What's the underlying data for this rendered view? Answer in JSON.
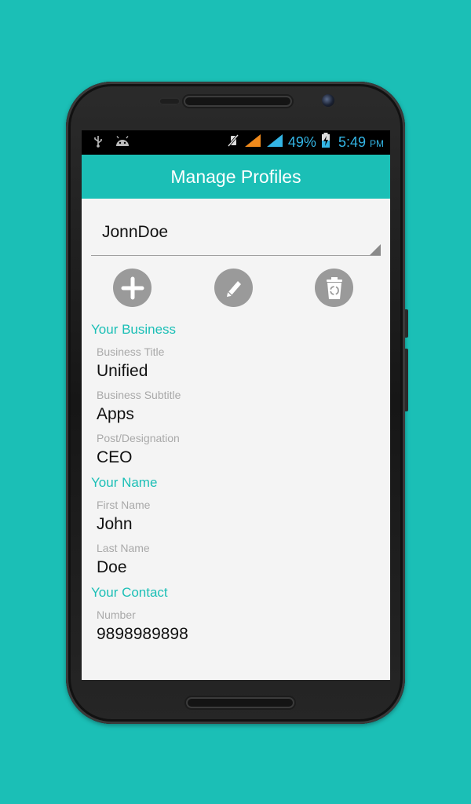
{
  "colors": {
    "accent": "#1bbfb6",
    "status_blue": "#33b5e5",
    "icon_grey": "#9a9a9a"
  },
  "statusbar": {
    "left_icons": [
      "usb-icon",
      "android-debug-icon"
    ],
    "right_icons": [
      "mute-vibrate-icon",
      "signal-orange-icon",
      "signal-blue-icon",
      "battery-charging-icon"
    ],
    "battery": "49%",
    "time": "5:49",
    "ampm": "PM"
  },
  "appbar": {
    "title": "Manage Profiles"
  },
  "profile_select": {
    "selected": "JonnDoe"
  },
  "actions": {
    "add_icon": "plus-icon",
    "edit_icon": "pencil-icon",
    "delete_icon": "trash-recycle-icon"
  },
  "business": {
    "heading": "Your Business",
    "title_label": "Business Title",
    "title_value": "Unified",
    "subtitle_label": "Business Subtitle",
    "subtitle_value": "Apps",
    "post_label": "Post/Designation",
    "post_value": "CEO"
  },
  "name": {
    "heading": "Your Name",
    "first_label": "First Name",
    "first_value": "John",
    "last_label": "Last Name",
    "last_value": "Doe"
  },
  "contact": {
    "heading": "Your Contact",
    "number_label": "Number",
    "number_value": "9898989898"
  }
}
